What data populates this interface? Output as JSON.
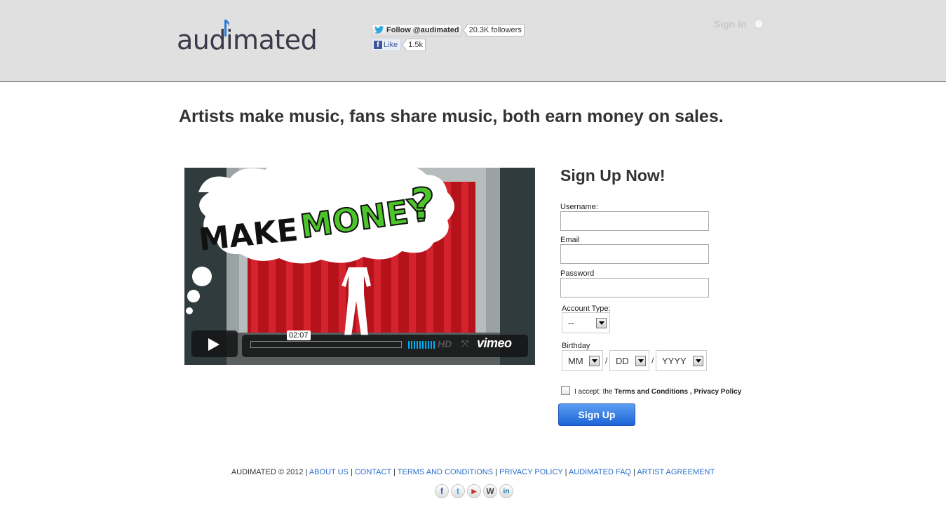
{
  "header": {
    "logo_text": "audimated",
    "twitter": {
      "follow_label": "Follow @audimated",
      "followers": "20.3K followers"
    },
    "facebook": {
      "like_label": "Like",
      "count": "1.5k"
    },
    "signin_label": "Sign In"
  },
  "main": {
    "tagline": "Artists make music, fans share music, both earn money on sales.",
    "video": {
      "title_word_1": "MAKE",
      "title_word_2": "MONEY",
      "title_word_3": "?",
      "time": "02:07",
      "hd_label": "HD",
      "brand": "vimeo"
    }
  },
  "signup": {
    "title": "Sign Up Now!",
    "username_label": "Username:",
    "email_label": "Email",
    "password_label": "Password",
    "account_type_label": "Account Type:",
    "account_type_value": "--",
    "birthday_label": "Birthday",
    "birthday_month": "MM",
    "birthday_day": "DD",
    "birthday_year": "YYYY",
    "separator": "/",
    "agree_prefix": "I accept: the",
    "terms_label": "Terms and Conditions",
    "comma": ",",
    "privacy_label": "Privacy Policy",
    "button_label": "Sign Up"
  },
  "footer": {
    "copyright": "AUDIMATED © 2012",
    "links": [
      "ABOUT US",
      "CONTACT",
      "TERMS AND CONDITIONS",
      "PRIVACY POLICY",
      "AUDIMATED FAQ",
      "ARTIST AGREEMENT"
    ],
    "social_icons": [
      "facebook-icon",
      "twitter-icon",
      "youtube-icon",
      "wordpress-icon",
      "linkedin-icon"
    ]
  },
  "colors": {
    "header_bg": "#e0e0e0",
    "link_blue": "#2a6fc9",
    "button_blue": "#1d64d6",
    "money_green": "#4cc52a"
  }
}
